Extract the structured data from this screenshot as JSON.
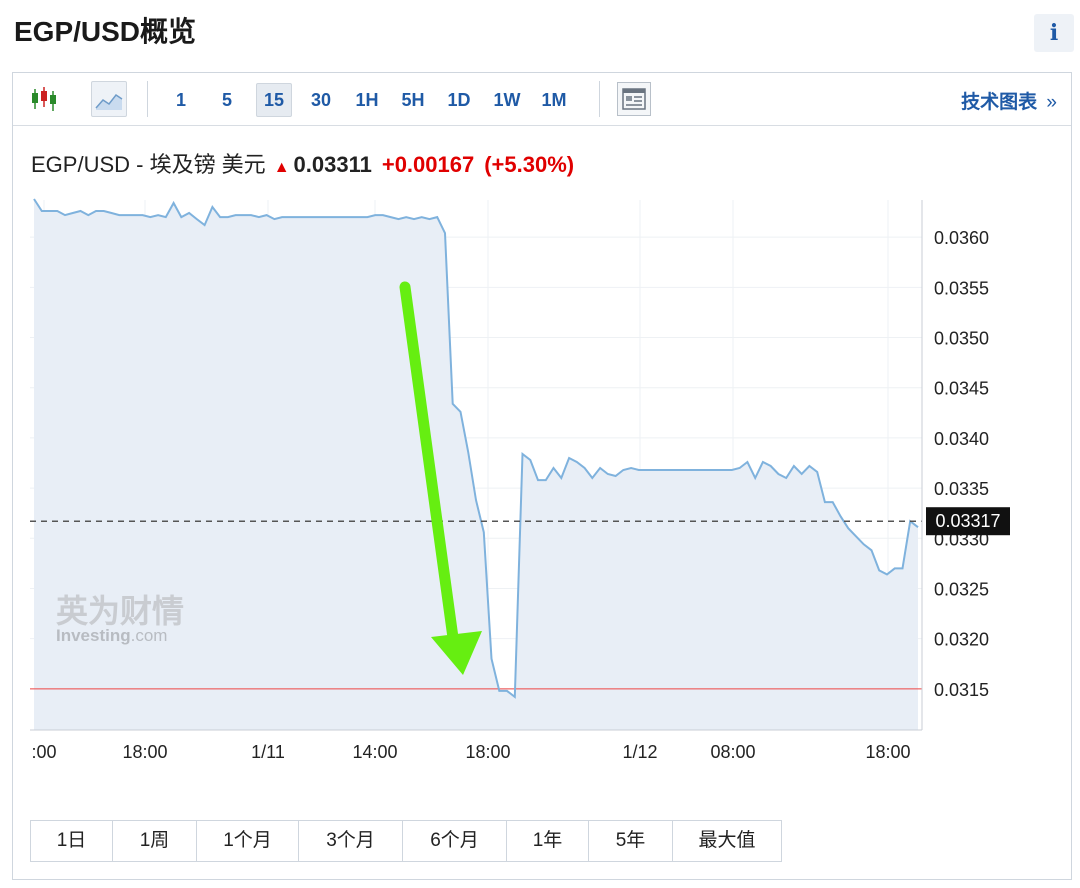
{
  "title": "EGP/USD概览",
  "info_icon": "i",
  "toolbar": {
    "intervals": [
      "1",
      "5",
      "15",
      "30",
      "1H",
      "5H",
      "1D",
      "1W",
      "1M"
    ],
    "active_interval": "15",
    "tech_chart_label": "技术图表",
    "tech_chart_arrow": "»",
    "icons": [
      "candlestick-icon",
      "area-chart-icon",
      "news-table-icon"
    ]
  },
  "quote": {
    "name": "EGP/USD - 埃及镑 美元",
    "direction_icon": "▲",
    "price": "0.03311",
    "change": "+0.00167",
    "change_pct": "(+5.30%)"
  },
  "watermark": {
    "cn": "英为财情",
    "en": "Investing",
    "suffix": ".com"
  },
  "ranges": [
    "1日",
    "1周",
    "1个月",
    "3个月",
    "6个月",
    "1年",
    "5年",
    "最大值"
  ],
  "colors": {
    "line": "#7fb2dd",
    "area": "#e8eef6",
    "arrow": "#66ee11",
    "up": "#e00000",
    "link": "#1f5aa6",
    "support_line": "#ee4444"
  },
  "chart_data": {
    "type": "area",
    "x_ticks": [
      ":00",
      "18:00",
      "1/11",
      "14:00",
      "18:00",
      "1/12",
      "08:00",
      "18:00"
    ],
    "y_ticks": [
      "0.0360",
      "0.0355",
      "0.0350",
      "0.0345",
      "0.0340",
      "0.0335",
      "0.0330",
      "0.0325",
      "0.0320",
      "0.0315"
    ],
    "ylim": [
      0.03109,
      0.03637
    ],
    "current_price_label": "0.03317",
    "current_price": 0.03317,
    "support_level": 0.0315,
    "series": [
      {
        "values": [
          0.03638,
          0.03626,
          0.03626,
          0.03626,
          0.03622,
          0.03624,
          0.03626,
          0.03622,
          0.03626,
          0.03626,
          0.03624,
          0.03622,
          0.03622,
          0.03622,
          0.03622,
          0.0362,
          0.03622,
          0.0362,
          0.03634,
          0.0362,
          0.03624,
          0.03618,
          0.03612,
          0.0363,
          0.0362,
          0.0362,
          0.03622,
          0.03622,
          0.03622,
          0.0362,
          0.03622,
          0.03618,
          0.0362,
          0.0362,
          0.0362,
          0.0362,
          0.0362,
          0.0362,
          0.0362,
          0.0362,
          0.0362,
          0.0362,
          0.0362,
          0.0362,
          0.03622,
          0.03622,
          0.0362,
          0.03618,
          0.0362,
          0.03618,
          0.0362,
          0.03618,
          0.0362,
          0.03604,
          0.03434,
          0.03426,
          0.03386,
          0.03338,
          0.03306,
          0.0318,
          0.03148,
          0.03148,
          0.03142,
          0.03384,
          0.03378,
          0.03358,
          0.03358,
          0.0337,
          0.0336,
          0.0338,
          0.03376,
          0.0337,
          0.0336,
          0.0337,
          0.03364,
          0.03362,
          0.03368,
          0.0337,
          0.03368,
          0.03368,
          0.03368,
          0.03368,
          0.03368,
          0.03368,
          0.03368,
          0.03368,
          0.03368,
          0.03368,
          0.03368,
          0.03368,
          0.03368,
          0.0337,
          0.03376,
          0.0336,
          0.03376,
          0.03372,
          0.03364,
          0.0336,
          0.03372,
          0.03364,
          0.03372,
          0.03366,
          0.03336,
          0.03336,
          0.03322,
          0.0331,
          0.03302,
          0.03294,
          0.03288,
          0.03268,
          0.03264,
          0.0327,
          0.0327,
          0.03317,
          0.03311
        ]
      }
    ]
  }
}
